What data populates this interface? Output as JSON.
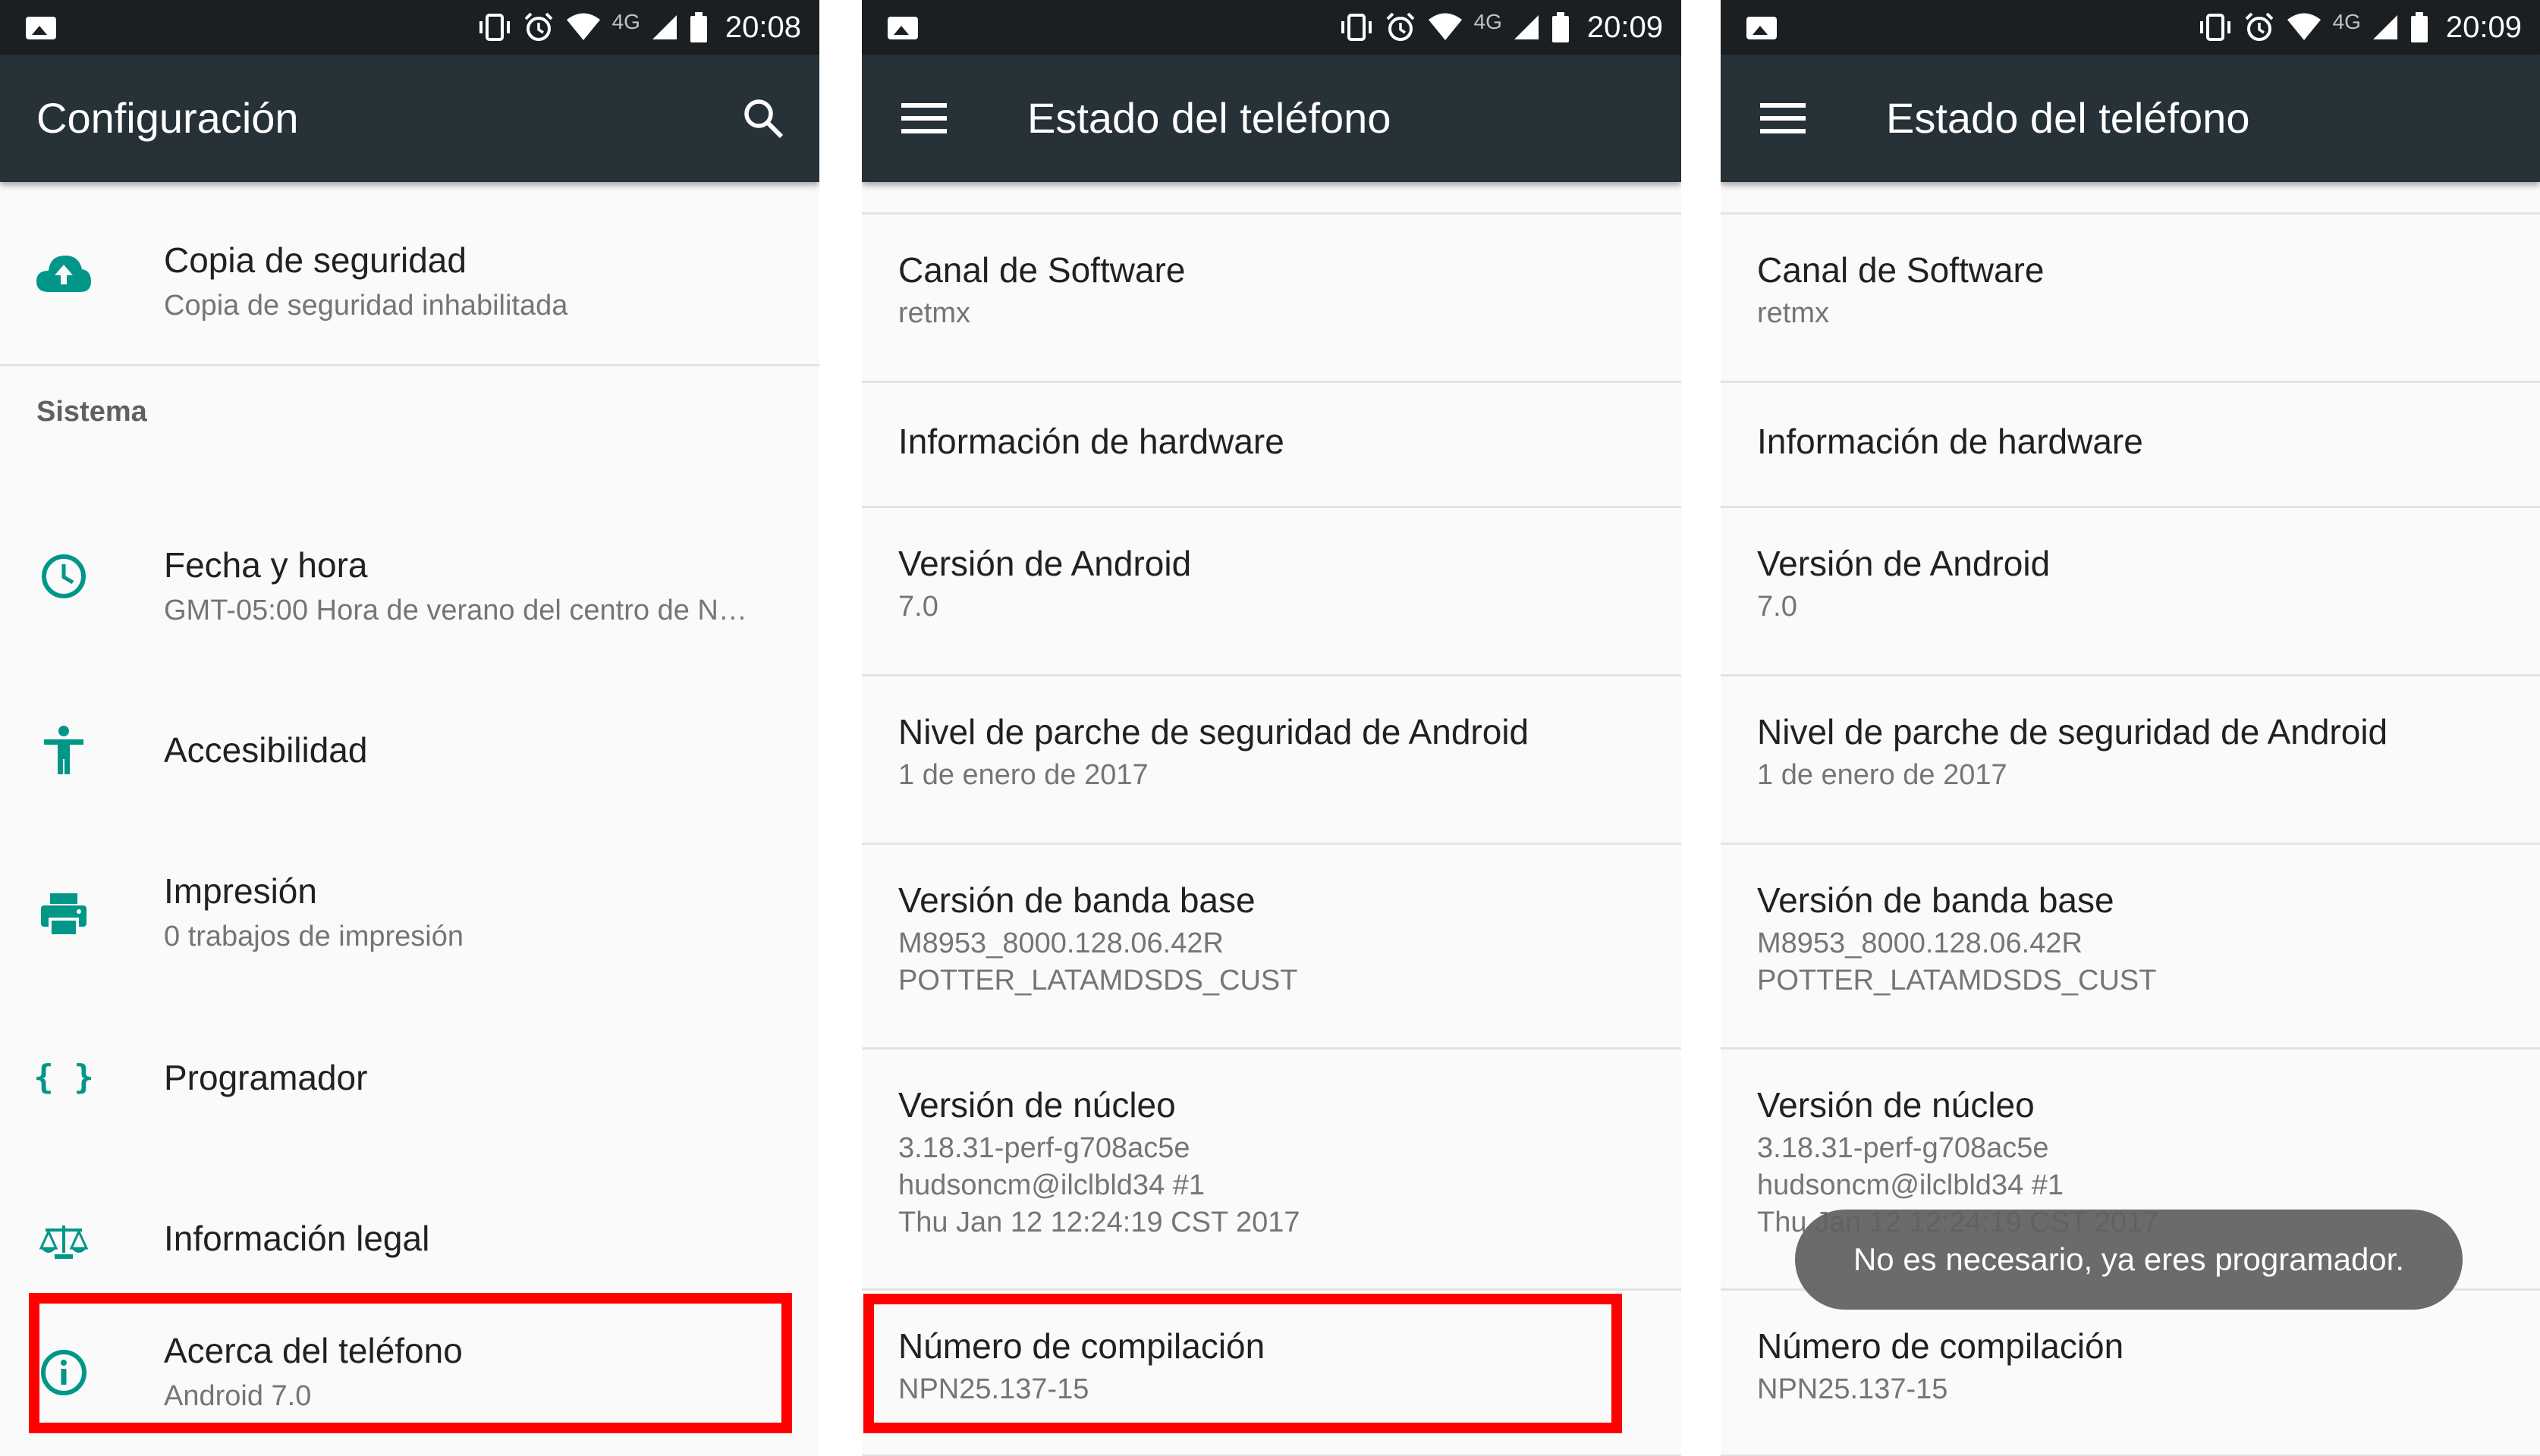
{
  "status_bars": [
    {
      "network": "4G",
      "time": "20:08"
    },
    {
      "network": "4G",
      "time": "20:09"
    },
    {
      "network": "4G",
      "time": "20:09"
    }
  ],
  "settings_screen": {
    "title": "Configuración",
    "backup": {
      "title": "Copia de seguridad",
      "subtitle": "Copia de seguridad inhabilitada",
      "icon": "cloud-upload-icon"
    },
    "section_header": "Sistema",
    "items": [
      {
        "title": "Fecha y hora",
        "subtitle": "GMT-05:00 Hora de verano del centro de N…",
        "icon": "clock-icon"
      },
      {
        "title": "Accesibilidad",
        "subtitle": "",
        "icon": "accessibility-icon"
      },
      {
        "title": "Impresión",
        "subtitle": "0 trabajos de impresión",
        "icon": "printer-icon"
      },
      {
        "title": "Programador",
        "subtitle": "",
        "icon": "developer-braces-icon",
        "glyph": "{ }"
      },
      {
        "title": "Información legal",
        "subtitle": "",
        "icon": "scales-icon"
      },
      {
        "title": "Acerca del teléfono",
        "subtitle": "Android 7.0",
        "icon": "info-icon"
      }
    ]
  },
  "phone_status": {
    "title": "Estado del teléfono",
    "rows": [
      {
        "title": "Canal de Software",
        "subtitle": "retmx"
      },
      {
        "title": "Información de hardware",
        "subtitle": ""
      },
      {
        "title": "Versión de Android",
        "subtitle": "7.0"
      },
      {
        "title": "Nivel de parche de seguridad de Android",
        "subtitle": "1 de enero de 2017"
      },
      {
        "title": "Versión de banda base",
        "subtitle_lines": [
          "M8953_8000.128.06.42R",
          "POTTER_LATAMDSDS_CUST"
        ]
      },
      {
        "title": "Versión de núcleo",
        "subtitle_lines": [
          "3.18.31-perf-g708ac5e",
          "hudsoncm@ilclbld34 #1",
          "Thu Jan 12 12:24:19 CST 2017"
        ]
      },
      {
        "title": "Número de compilación",
        "subtitle": "NPN25.137-15"
      }
    ]
  },
  "toast": {
    "message": "No es necesario, ya eres programador."
  },
  "colors": {
    "status_bar": "#1b1f21",
    "toolbar": "#263238",
    "accent": "#009688",
    "highlight": "#ff0000",
    "background": "#fafafa"
  }
}
